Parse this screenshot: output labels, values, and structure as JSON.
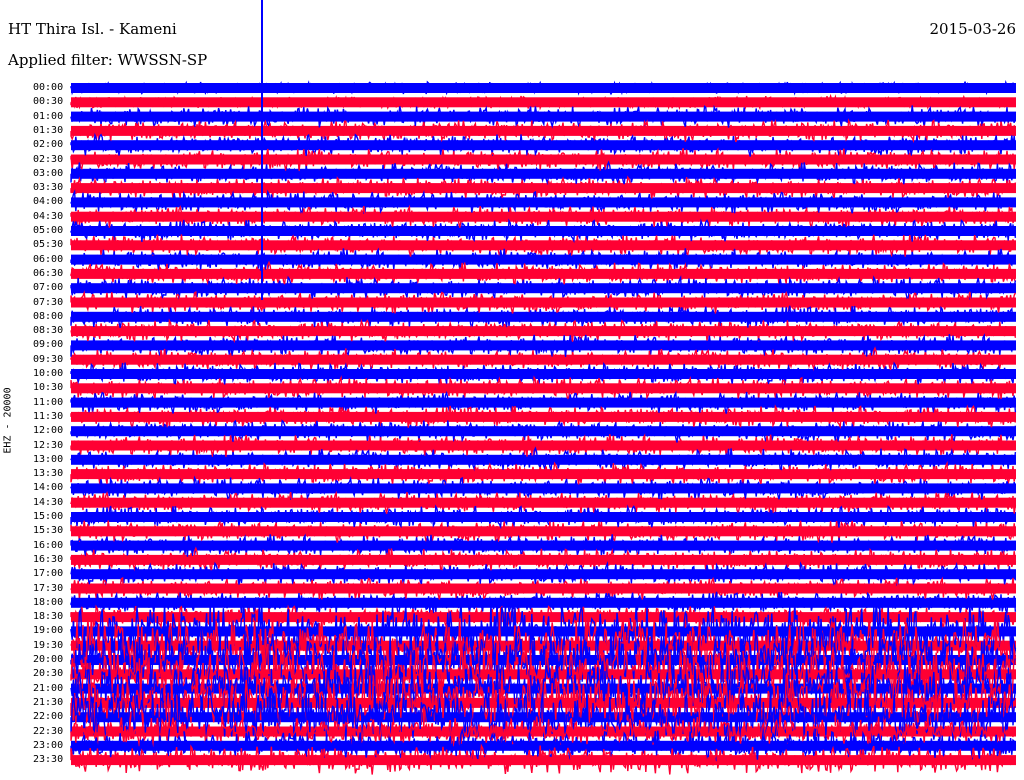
{
  "header": {
    "station": "HT Thira Isl. - Kameni",
    "filter": "Applied filter: WWSSN-SP",
    "date": "2015-03-26"
  },
  "chart_data": {
    "type": "heliplot",
    "title": "HT Thira Isl. - Kameni",
    "subtitle": "Applied filter: WWSSN-SP",
    "ylabel": "EHZ - 20000",
    "date": "2015-03-26",
    "tick_labels": [
      "00:00",
      "00:30",
      "01:00",
      "01:30",
      "02:00",
      "02:30",
      "03:00",
      "03:30",
      "04:00",
      "04:30",
      "05:00",
      "05:30",
      "06:00",
      "06:30",
      "07:00",
      "07:30",
      "08:00",
      "08:30",
      "09:00",
      "09:30",
      "10:00",
      "10:30",
      "11:00",
      "11:30",
      "12:00",
      "12:30",
      "13:00",
      "13:30",
      "14:00",
      "14:30",
      "15:00",
      "15:30",
      "16:00",
      "16:30",
      "17:00",
      "17:30",
      "18:00",
      "18:30",
      "19:00",
      "19:30",
      "20:00",
      "20:30",
      "21:00",
      "21:30",
      "22:00",
      "22:30",
      "23:00",
      "23:30"
    ],
    "trace_colors": [
      "#0000ff",
      "#ff0033"
    ],
    "grid": false
  }
}
